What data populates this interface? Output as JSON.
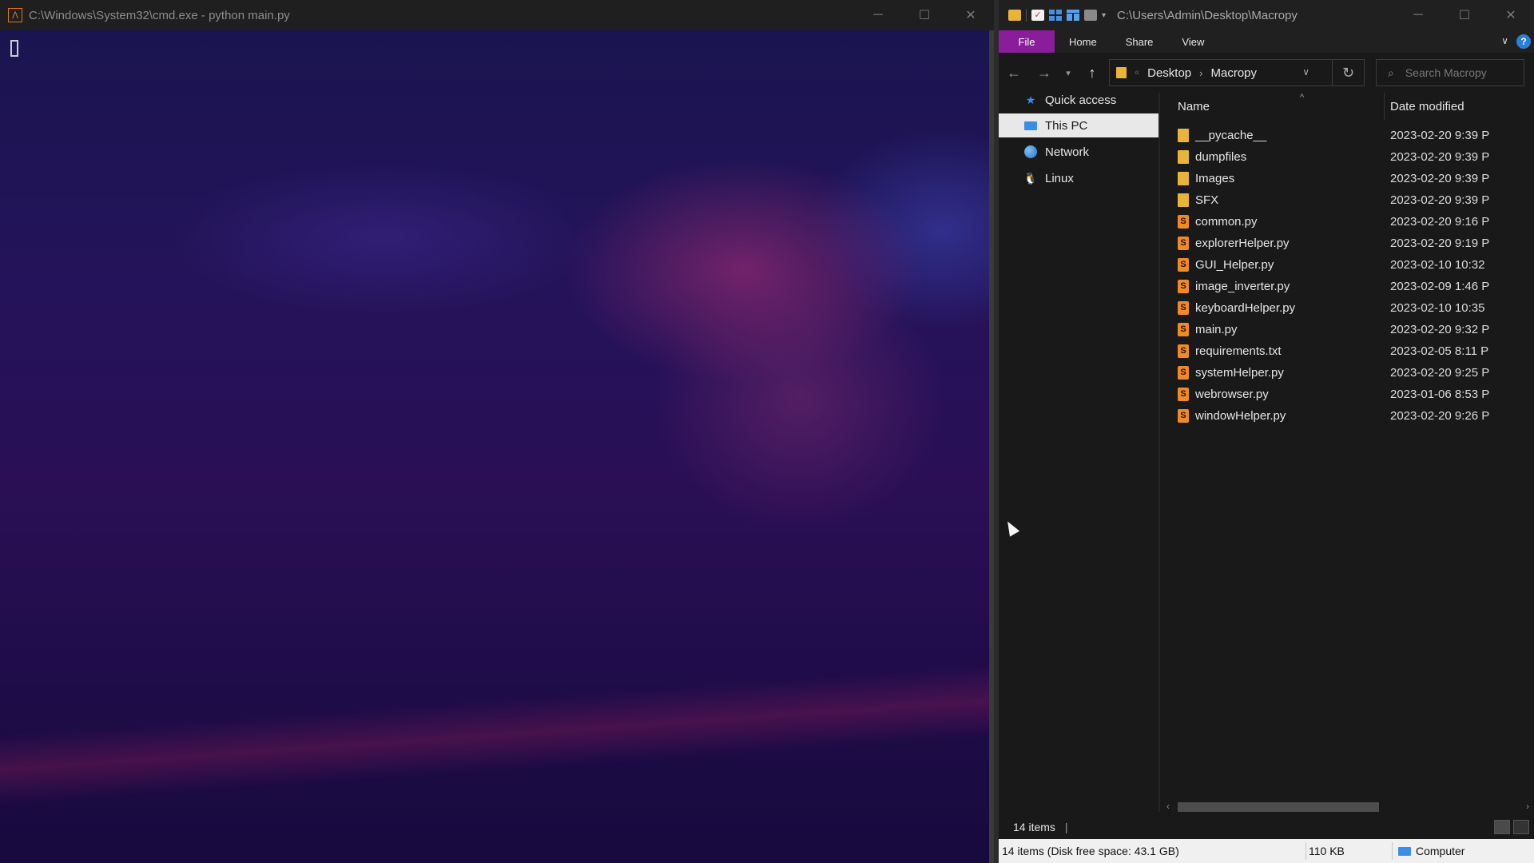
{
  "cmd": {
    "title": "C:\\Windows\\System32\\cmd.exe - python  main.py",
    "icon": "cmd-app-icon",
    "controls": {
      "minimize": "─",
      "maximize": "☐",
      "close": "✕"
    }
  },
  "explorer": {
    "title_path": "C:\\Users\\Admin\\Desktop\\Macropy",
    "controls": {
      "minimize": "─",
      "maximize": "☐",
      "close": "✕"
    },
    "ribbon": {
      "tabs": [
        "File",
        "Home",
        "Share",
        "View"
      ],
      "file_color": "#8a1d9a"
    },
    "address": {
      "overflow": "«",
      "crumbs": [
        "Desktop",
        "Macropy"
      ],
      "separator": "›"
    },
    "search": {
      "placeholder": "Search Macropy"
    },
    "nav_pane": [
      {
        "label": "Quick access",
        "icon": "star-icon"
      },
      {
        "label": "This PC",
        "icon": "computer-icon",
        "selected": true
      },
      {
        "label": "Network",
        "icon": "network-icon"
      },
      {
        "label": "Linux",
        "icon": "tux-icon"
      }
    ],
    "columns": {
      "name": "Name",
      "date": "Date modified"
    },
    "files": [
      {
        "name": "__pycache__",
        "type": "folder",
        "date": "2023-02-20 9:39 P"
      },
      {
        "name": "dumpfiles",
        "type": "folder",
        "date": "2023-02-20 9:39 P"
      },
      {
        "name": "Images",
        "type": "folder",
        "date": "2023-02-20 9:39 P"
      },
      {
        "name": "SFX",
        "type": "folder",
        "date": "2023-02-20 9:39 P"
      },
      {
        "name": "common.py",
        "type": "sublime",
        "date": "2023-02-20 9:16 P"
      },
      {
        "name": "explorerHelper.py",
        "type": "sublime",
        "date": "2023-02-20 9:19 P"
      },
      {
        "name": "GUI_Helper.py",
        "type": "sublime",
        "date": "2023-02-10 10:32"
      },
      {
        "name": "image_inverter.py",
        "type": "sublime",
        "date": "2023-02-09 1:46 P"
      },
      {
        "name": "keyboardHelper.py",
        "type": "sublime",
        "date": "2023-02-10 10:35"
      },
      {
        "name": "main.py",
        "type": "sublime",
        "date": "2023-02-20 9:32 P"
      },
      {
        "name": "requirements.txt",
        "type": "sublime",
        "date": "2023-02-05 8:11 P"
      },
      {
        "name": "systemHelper.py",
        "type": "sublime",
        "date": "2023-02-20 9:25 P"
      },
      {
        "name": "webrowser.py",
        "type": "sublime",
        "date": "2023-01-06 8:53 P"
      },
      {
        "name": "windowHelper.py",
        "type": "sublime",
        "date": "2023-02-20 9:26 P"
      }
    ],
    "status": {
      "item_count": "14 items",
      "separator": "|",
      "info": "14 items (Disk free space: 43.1 GB)",
      "size": "110 KB",
      "location": "Computer"
    }
  }
}
